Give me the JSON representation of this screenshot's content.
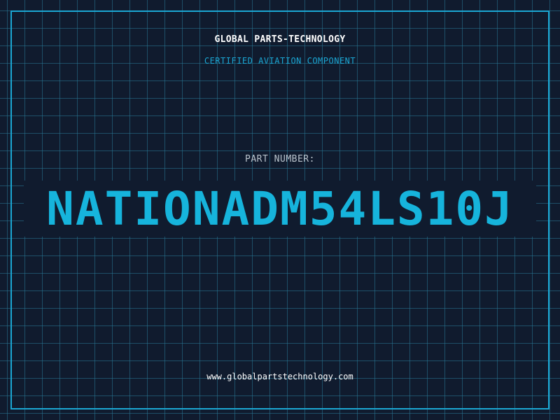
{
  "header": {
    "company": "GLOBAL PARTS-TECHNOLOGY",
    "subtitle": "CERTIFIED AVIATION COMPONENT"
  },
  "part": {
    "label": "PART NUMBER:",
    "number": "NATIONADM54LS10J"
  },
  "footer": {
    "url": "www.globalpartstechnology.com"
  },
  "colors": {
    "background": "#101b2e",
    "grid": "#28788f",
    "accent": "#1ba6d3",
    "part_number": "#16b4dc",
    "label": "#b9c3cc",
    "text": "#ffffff"
  }
}
